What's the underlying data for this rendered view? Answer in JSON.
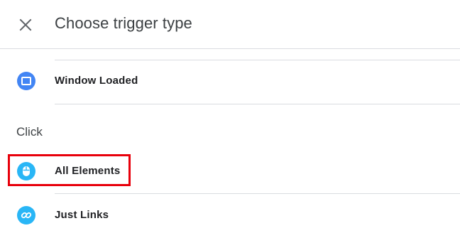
{
  "header": {
    "title": "Choose trigger type",
    "close_icon": "close-icon"
  },
  "items": [
    {
      "label": "Window Loaded",
      "icon": "window-icon",
      "icon_color": "#4285f4"
    },
    {
      "label": "All Elements",
      "icon": "mouse-icon",
      "icon_color": "#29b6f6"
    },
    {
      "label": "Just Links",
      "icon": "link-icon",
      "icon_color": "#29b6f6"
    }
  ],
  "sections": {
    "click_label": "Click"
  },
  "colors": {
    "highlight": "#e8000b"
  }
}
